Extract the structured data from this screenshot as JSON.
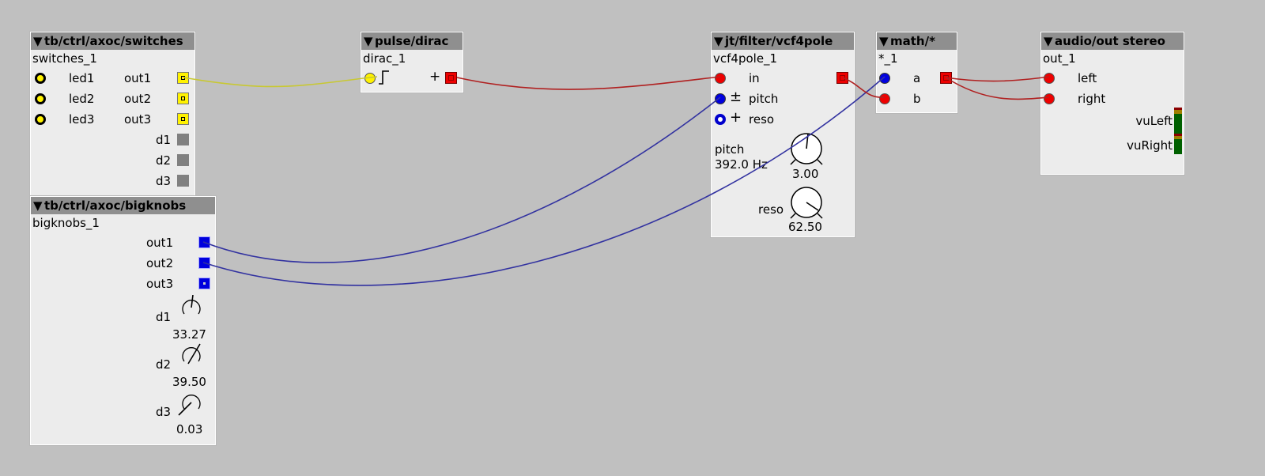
{
  "objects": {
    "switches": {
      "type": "tb/ctrl/axoc/switches",
      "instance": "switches_1",
      "leds": [
        "led1",
        "led2",
        "led3"
      ],
      "outs": [
        "out1",
        "out2",
        "out3"
      ],
      "params": [
        "d1",
        "d2",
        "d3"
      ]
    },
    "bigknobs": {
      "type": "tb/ctrl/axoc/bigknobs",
      "instance": "bigknobs_1",
      "outs": [
        "out1",
        "out2",
        "out3"
      ],
      "knobs": [
        {
          "label": "d1",
          "value": "33.27"
        },
        {
          "label": "d2",
          "value": "39.50"
        },
        {
          "label": "d3",
          "value": "0.03"
        }
      ]
    },
    "dirac": {
      "type": "pulse/dirac",
      "instance": "dirac_1",
      "out_symbol": "+"
    },
    "vcf": {
      "type": "jt/filter/vcf4pole",
      "instance": "vcf4pole_1",
      "inlets": [
        {
          "label": "in",
          "symbol": ""
        },
        {
          "label": "pitch",
          "symbol": "±"
        },
        {
          "label": "reso",
          "symbol": "+"
        }
      ],
      "pitch_label": "pitch",
      "pitch_readout": "392.0 Hz",
      "pitch_value": "3.00",
      "reso_label": "reso",
      "reso_value": "62.50"
    },
    "mult": {
      "type": "math/*",
      "instance": "*_1",
      "inlets": [
        "a",
        "b"
      ]
    },
    "audioout": {
      "type": "audio/out stereo",
      "instance": "out_1",
      "inlets": [
        "left",
        "right"
      ],
      "vu": [
        "vuLeft",
        "vuRight"
      ]
    }
  },
  "colors": {
    "background": "#c0c0c0",
    "wire_bool": "#c8c832",
    "wire_audio": "#b02020",
    "wire_frac": "#3232a0"
  }
}
